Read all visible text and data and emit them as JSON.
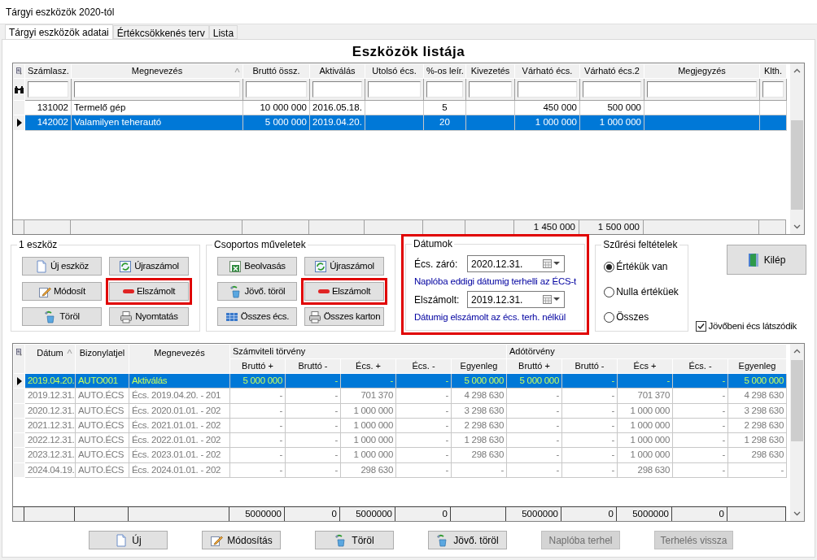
{
  "window": {
    "title": "Tárgyi eszközök 2020-tól"
  },
  "tabs": [
    {
      "label": "Tárgyi eszközök adatai",
      "selected": true
    },
    {
      "label": "Értékcsökkenés terv",
      "selected": false
    },
    {
      "label": "Lista",
      "selected": false
    }
  ],
  "asset_list": {
    "title": "Eszközök listája",
    "columns": [
      {
        "label": "Számlasz.",
        "sorted": false
      },
      {
        "label": "Megnevezés",
        "sorted": true
      },
      {
        "label": "Bruttó össz.",
        "sorted": false
      },
      {
        "label": "Aktiválás",
        "sorted": false
      },
      {
        "label": "Utolsó écs.",
        "sorted": false
      },
      {
        "label": "%-os leír.",
        "sorted": false
      },
      {
        "label": "Kivezetés",
        "sorted": false
      },
      {
        "label": "Várható écs.",
        "sorted": false,
        "total": "1 450 000"
      },
      {
        "label": "Várható écs.2",
        "sorted": false,
        "total": "1 500 000"
      },
      {
        "label": "Megjegyzés",
        "sorted": false
      },
      {
        "label": "Klth.",
        "sorted": false
      }
    ],
    "rows": [
      {
        "selected": false,
        "account": "131002",
        "name": "Termelő gép",
        "gross": "10 000 000",
        "activation": "2016.05.18.",
        "rate": "5",
        "expected": "450 000",
        "expected_2": "500 000"
      },
      {
        "selected": true,
        "account": "142002",
        "name": "Valamilyen teherautó",
        "gross": "5 000 000",
        "activation": "2019.04.20.",
        "rate": "20",
        "expected": "1 000 000",
        "expected_2": "1 000 000"
      }
    ]
  },
  "single_asset": {
    "title": "1 eszköz",
    "buttons": [
      {
        "label": "Új eszköz",
        "kind": "document",
        "highlighted": false
      },
      {
        "label": "Újraszámol",
        "kind": "refresh",
        "highlighted": false
      },
      {
        "label": "Módosít",
        "kind": "pencil",
        "highlighted": false
      },
      {
        "label": "Elszámolt",
        "kind": "minus",
        "highlighted": true
      },
      {
        "label": "Töröl",
        "kind": "bin",
        "highlighted": false
      },
      {
        "label": "Nyomtatás",
        "kind": "printer",
        "highlighted": false
      }
    ]
  },
  "group_operations": {
    "title": "Csoportos műveletek",
    "buttons": [
      {
        "label": "Beolvasás",
        "kind": "spreadsheet",
        "highlighted": false
      },
      {
        "label": "Újraszámol",
        "kind": "refresh",
        "highlighted": false
      },
      {
        "label": "Jövő. töröl",
        "kind": "bin",
        "highlighted": false
      },
      {
        "label": "Elszámolt",
        "kind": "minus",
        "highlighted": true
      },
      {
        "label": "Összes écs.",
        "kind": "table",
        "highlighted": false
      },
      {
        "label": "Összes karton",
        "kind": "printer",
        "highlighted": false
      }
    ]
  },
  "dates": {
    "title": "Dátumok",
    "highlighted": true,
    "fields": [
      {
        "label": "Écs. záró:",
        "value": "2020.12.31.",
        "hint": "Naplóba eddigi dátumig terhelli az ÉCS-t"
      },
      {
        "label": "Elszámolt:",
        "value": "2019.12.31.",
        "hint": "Dátumig elszámolt az écs. terh. nélkül"
      }
    ]
  },
  "filters": {
    "title": "Szűrési feltételek",
    "options": [
      {
        "label": "Értékük van",
        "selected": true
      },
      {
        "label": "Nulla értéküek",
        "selected": false
      },
      {
        "label": "Összes",
        "selected": false
      }
    ]
  },
  "exit_button": {
    "label": "Kilép"
  },
  "future_checkbox": {
    "label": "Jövőbeni écs látszódik",
    "checked": true
  },
  "ledger": {
    "columns": [
      {
        "label": "Dátum",
        "sorted": true
      },
      {
        "label": "Bizonylatjel",
        "sorted": false
      },
      {
        "label": "Megnevezés",
        "sorted": false
      }
    ],
    "groups": [
      {
        "label": "Számviteli törvény",
        "columns": [
          {
            "label": "Bruttó +",
            "total": "5000000"
          },
          {
            "label": "Bruttó -",
            "total": "0"
          },
          {
            "label": "Écs. +",
            "total": "5000000"
          },
          {
            "label": "Écs. -",
            "total": "0"
          },
          {
            "label": "Egyenleg"
          }
        ]
      },
      {
        "label": "Adótörvény",
        "columns": [
          {
            "label": "Bruttó +",
            "total": "5000000"
          },
          {
            "label": "Bruttó -",
            "total": "0"
          },
          {
            "label": "Écs +",
            "total": "5000000"
          },
          {
            "label": "Écs. -",
            "total": "0"
          },
          {
            "label": "Egyenleg"
          }
        ]
      }
    ],
    "rows": [
      {
        "selected": true,
        "greyed": false,
        "cells": [
          "2019.04.20.",
          "AUTO001",
          "Aktiválás",
          "5 000 000",
          "-",
          "-",
          "-",
          "5 000 000",
          "5 000 000",
          "-",
          "-",
          "-",
          "5 000 000"
        ]
      },
      {
        "selected": false,
        "greyed": true,
        "cells": [
          "2019.12.31.",
          "AUTO.ÉCS",
          "Écs. 2019.04.20. - 201",
          "-",
          "-",
          "701 370",
          "-",
          "4 298 630",
          "-",
          "-",
          "701 370",
          "-",
          "4 298 630"
        ]
      },
      {
        "selected": false,
        "greyed": true,
        "cells": [
          "2020.12.31.",
          "AUTO.ÉCS",
          "Écs. 2020.01.01. - 202",
          "-",
          "-",
          "1 000 000",
          "-",
          "3 298 630",
          "-",
          "-",
          "1 000 000",
          "-",
          "3 298 630"
        ]
      },
      {
        "selected": false,
        "greyed": true,
        "cells": [
          "2021.12.31.",
          "AUTO.ÉCS",
          "Écs. 2021.01.01. - 202",
          "-",
          "-",
          "1 000 000",
          "-",
          "2 298 630",
          "-",
          "-",
          "1 000 000",
          "-",
          "2 298 630"
        ]
      },
      {
        "selected": false,
        "greyed": true,
        "cells": [
          "2022.12.31.",
          "AUTO.ÉCS",
          "Écs. 2022.01.01. - 202",
          "-",
          "-",
          "1 000 000",
          "-",
          "1 298 630",
          "-",
          "-",
          "1 000 000",
          "-",
          "1 298 630"
        ]
      },
      {
        "selected": false,
        "greyed": true,
        "cells": [
          "2023.12.31.",
          "AUTO.ÉCS",
          "Écs. 2023.01.01. - 202",
          "-",
          "-",
          "1 000 000",
          "-",
          "298 630",
          "-",
          "-",
          "1 000 000",
          "-",
          "298 630"
        ]
      },
      {
        "selected": false,
        "greyed": true,
        "cells": [
          "2024.04.19.",
          "AUTO.ÉCS",
          "Écs. 2024.01.01. - 202",
          "-",
          "-",
          "298 630",
          "-",
          "-",
          "-",
          "-",
          "298 630",
          "-",
          "-"
        ]
      }
    ]
  },
  "bottom_buttons": [
    {
      "label": "Új",
      "kind": "document",
      "disabled": false
    },
    {
      "label": "Módosítás",
      "kind": "pencil",
      "disabled": false
    },
    {
      "label": "Töröl",
      "kind": "bin",
      "disabled": false
    },
    {
      "label": "Jövő. töröl",
      "kind": "bin",
      "disabled": false
    },
    {
      "label": "Naplóba terhel",
      "kind": "none",
      "disabled": true
    },
    {
      "label": "Terhelés vissza",
      "kind": "none",
      "disabled": true
    }
  ]
}
